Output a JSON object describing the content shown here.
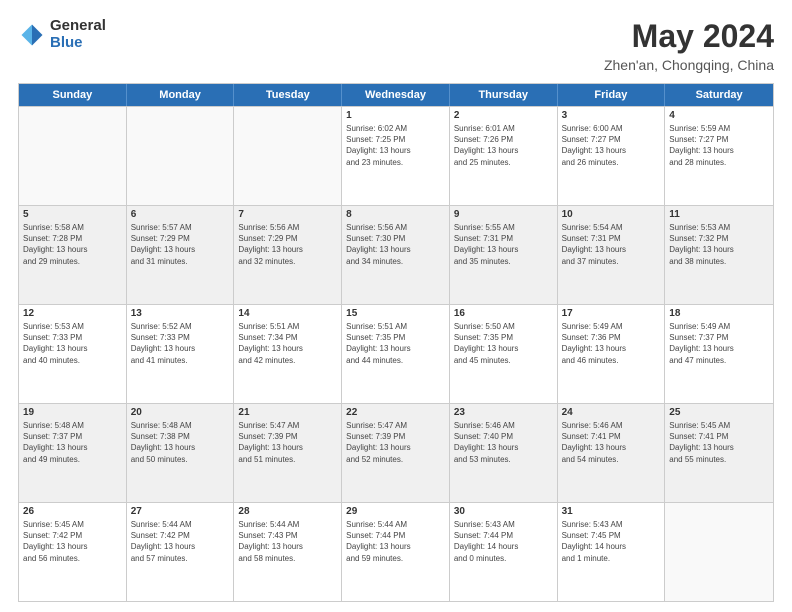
{
  "logo": {
    "general": "General",
    "blue": "Blue"
  },
  "title": "May 2024",
  "subtitle": "Zhen'an, Chongqing, China",
  "headers": [
    "Sunday",
    "Monday",
    "Tuesday",
    "Wednesday",
    "Thursday",
    "Friday",
    "Saturday"
  ],
  "weeks": [
    [
      {
        "day": "",
        "info": "",
        "empty": true
      },
      {
        "day": "",
        "info": "",
        "empty": true
      },
      {
        "day": "",
        "info": "",
        "empty": true
      },
      {
        "day": "1",
        "info": "Sunrise: 6:02 AM\nSunset: 7:25 PM\nDaylight: 13 hours\nand 23 minutes.",
        "empty": false
      },
      {
        "day": "2",
        "info": "Sunrise: 6:01 AM\nSunset: 7:26 PM\nDaylight: 13 hours\nand 25 minutes.",
        "empty": false
      },
      {
        "day": "3",
        "info": "Sunrise: 6:00 AM\nSunset: 7:27 PM\nDaylight: 13 hours\nand 26 minutes.",
        "empty": false
      },
      {
        "day": "4",
        "info": "Sunrise: 5:59 AM\nSunset: 7:27 PM\nDaylight: 13 hours\nand 28 minutes.",
        "empty": false
      }
    ],
    [
      {
        "day": "5",
        "info": "Sunrise: 5:58 AM\nSunset: 7:28 PM\nDaylight: 13 hours\nand 29 minutes.",
        "empty": false,
        "shaded": true
      },
      {
        "day": "6",
        "info": "Sunrise: 5:57 AM\nSunset: 7:29 PM\nDaylight: 13 hours\nand 31 minutes.",
        "empty": false,
        "shaded": true
      },
      {
        "day": "7",
        "info": "Sunrise: 5:56 AM\nSunset: 7:29 PM\nDaylight: 13 hours\nand 32 minutes.",
        "empty": false,
        "shaded": true
      },
      {
        "day": "8",
        "info": "Sunrise: 5:56 AM\nSunset: 7:30 PM\nDaylight: 13 hours\nand 34 minutes.",
        "empty": false,
        "shaded": true
      },
      {
        "day": "9",
        "info": "Sunrise: 5:55 AM\nSunset: 7:31 PM\nDaylight: 13 hours\nand 35 minutes.",
        "empty": false,
        "shaded": true
      },
      {
        "day": "10",
        "info": "Sunrise: 5:54 AM\nSunset: 7:31 PM\nDaylight: 13 hours\nand 37 minutes.",
        "empty": false,
        "shaded": true
      },
      {
        "day": "11",
        "info": "Sunrise: 5:53 AM\nSunset: 7:32 PM\nDaylight: 13 hours\nand 38 minutes.",
        "empty": false,
        "shaded": true
      }
    ],
    [
      {
        "day": "12",
        "info": "Sunrise: 5:53 AM\nSunset: 7:33 PM\nDaylight: 13 hours\nand 40 minutes.",
        "empty": false
      },
      {
        "day": "13",
        "info": "Sunrise: 5:52 AM\nSunset: 7:33 PM\nDaylight: 13 hours\nand 41 minutes.",
        "empty": false
      },
      {
        "day": "14",
        "info": "Sunrise: 5:51 AM\nSunset: 7:34 PM\nDaylight: 13 hours\nand 42 minutes.",
        "empty": false
      },
      {
        "day": "15",
        "info": "Sunrise: 5:51 AM\nSunset: 7:35 PM\nDaylight: 13 hours\nand 44 minutes.",
        "empty": false
      },
      {
        "day": "16",
        "info": "Sunrise: 5:50 AM\nSunset: 7:35 PM\nDaylight: 13 hours\nand 45 minutes.",
        "empty": false
      },
      {
        "day": "17",
        "info": "Sunrise: 5:49 AM\nSunset: 7:36 PM\nDaylight: 13 hours\nand 46 minutes.",
        "empty": false
      },
      {
        "day": "18",
        "info": "Sunrise: 5:49 AM\nSunset: 7:37 PM\nDaylight: 13 hours\nand 47 minutes.",
        "empty": false
      }
    ],
    [
      {
        "day": "19",
        "info": "Sunrise: 5:48 AM\nSunset: 7:37 PM\nDaylight: 13 hours\nand 49 minutes.",
        "empty": false,
        "shaded": true
      },
      {
        "day": "20",
        "info": "Sunrise: 5:48 AM\nSunset: 7:38 PM\nDaylight: 13 hours\nand 50 minutes.",
        "empty": false,
        "shaded": true
      },
      {
        "day": "21",
        "info": "Sunrise: 5:47 AM\nSunset: 7:39 PM\nDaylight: 13 hours\nand 51 minutes.",
        "empty": false,
        "shaded": true
      },
      {
        "day": "22",
        "info": "Sunrise: 5:47 AM\nSunset: 7:39 PM\nDaylight: 13 hours\nand 52 minutes.",
        "empty": false,
        "shaded": true
      },
      {
        "day": "23",
        "info": "Sunrise: 5:46 AM\nSunset: 7:40 PM\nDaylight: 13 hours\nand 53 minutes.",
        "empty": false,
        "shaded": true
      },
      {
        "day": "24",
        "info": "Sunrise: 5:46 AM\nSunset: 7:41 PM\nDaylight: 13 hours\nand 54 minutes.",
        "empty": false,
        "shaded": true
      },
      {
        "day": "25",
        "info": "Sunrise: 5:45 AM\nSunset: 7:41 PM\nDaylight: 13 hours\nand 55 minutes.",
        "empty": false,
        "shaded": true
      }
    ],
    [
      {
        "day": "26",
        "info": "Sunrise: 5:45 AM\nSunset: 7:42 PM\nDaylight: 13 hours\nand 56 minutes.",
        "empty": false
      },
      {
        "day": "27",
        "info": "Sunrise: 5:44 AM\nSunset: 7:42 PM\nDaylight: 13 hours\nand 57 minutes.",
        "empty": false
      },
      {
        "day": "28",
        "info": "Sunrise: 5:44 AM\nSunset: 7:43 PM\nDaylight: 13 hours\nand 58 minutes.",
        "empty": false
      },
      {
        "day": "29",
        "info": "Sunrise: 5:44 AM\nSunset: 7:44 PM\nDaylight: 13 hours\nand 59 minutes.",
        "empty": false
      },
      {
        "day": "30",
        "info": "Sunrise: 5:43 AM\nSunset: 7:44 PM\nDaylight: 14 hours\nand 0 minutes.",
        "empty": false
      },
      {
        "day": "31",
        "info": "Sunrise: 5:43 AM\nSunset: 7:45 PM\nDaylight: 14 hours\nand 1 minute.",
        "empty": false
      },
      {
        "day": "",
        "info": "",
        "empty": true
      }
    ]
  ]
}
